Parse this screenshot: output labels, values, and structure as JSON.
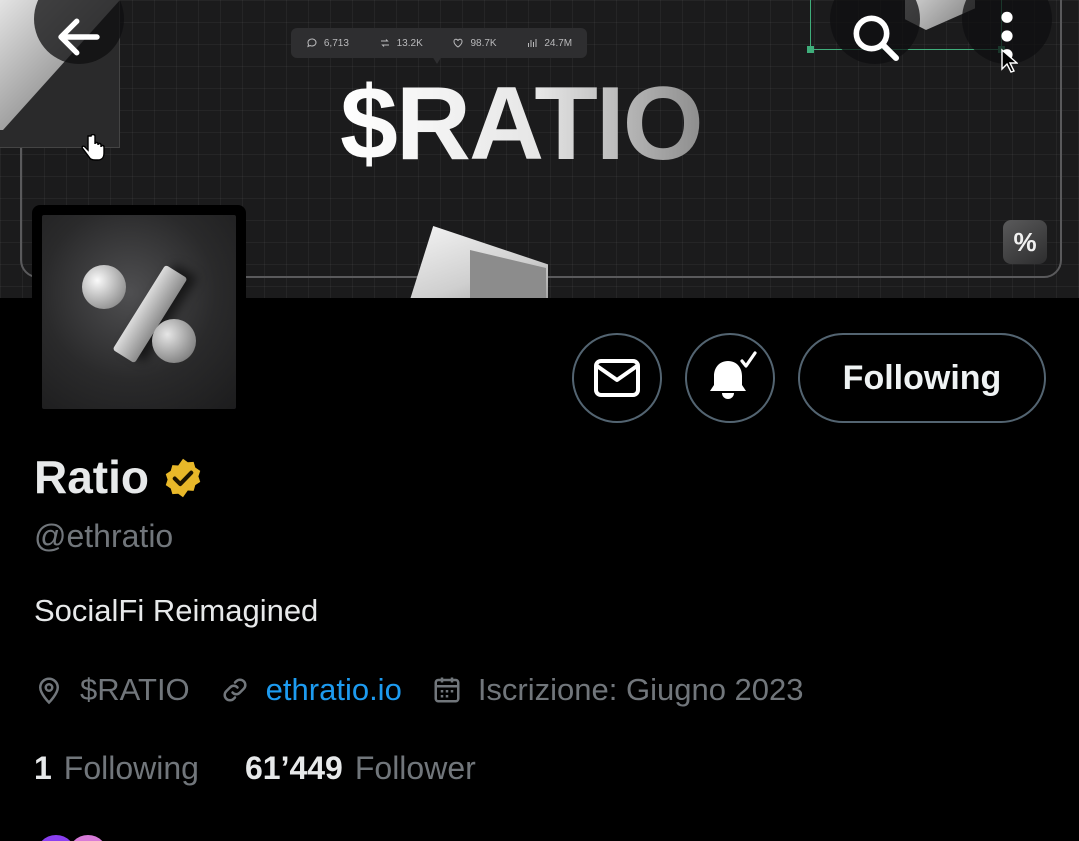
{
  "banner": {
    "title": "$RATIO",
    "stats": {
      "replies": "6,713",
      "reposts": "13.2K",
      "likes": "98.7K",
      "views": "24.7M"
    },
    "logo_glyph": "%"
  },
  "actions": {
    "following_label": "Following"
  },
  "profile": {
    "display_name": "Ratio",
    "handle": "@ethratio",
    "bio": "SocialFi Reimagined",
    "location": "$RATIO",
    "website": "ethratio.io",
    "joined": "Iscrizione: Giugno 2023",
    "following_count": "1",
    "following_label": "Following",
    "followers_count": "61’449",
    "followers_label": "Follower"
  },
  "colors": {
    "background": "#000000",
    "link": "#1d9bf0",
    "muted_text": "#71767b",
    "button_border": "#536471",
    "verified_badge": "#e8b829"
  },
  "icons": {
    "back": "arrow-left-icon",
    "search": "search-icon",
    "more": "more-vertical-icon",
    "message": "envelope-icon",
    "notifications": "bell-check-icon",
    "verified": "verified-badge-icon",
    "location": "location-pin-icon",
    "link": "link-icon",
    "calendar": "calendar-icon"
  }
}
